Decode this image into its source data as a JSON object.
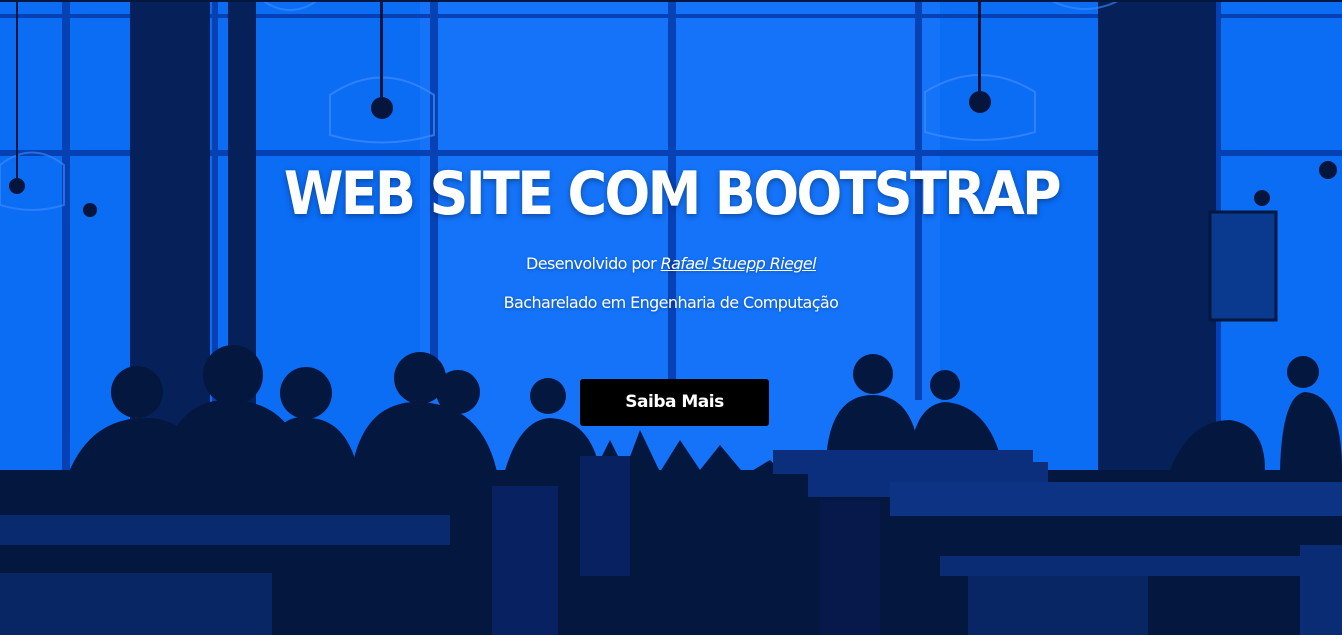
{
  "hero": {
    "background_color": "#0a6cf5",
    "silhouette_color": "#04173f",
    "title": "WEB SITE COM BOOTSTRAP",
    "developed_prefix": "Desenvolvido por",
    "author_name": "Rafael Stuepp Riegel",
    "subtitle": "Bacharelado em Engenharia de Computação",
    "cta_label": "Saiba Mais"
  }
}
